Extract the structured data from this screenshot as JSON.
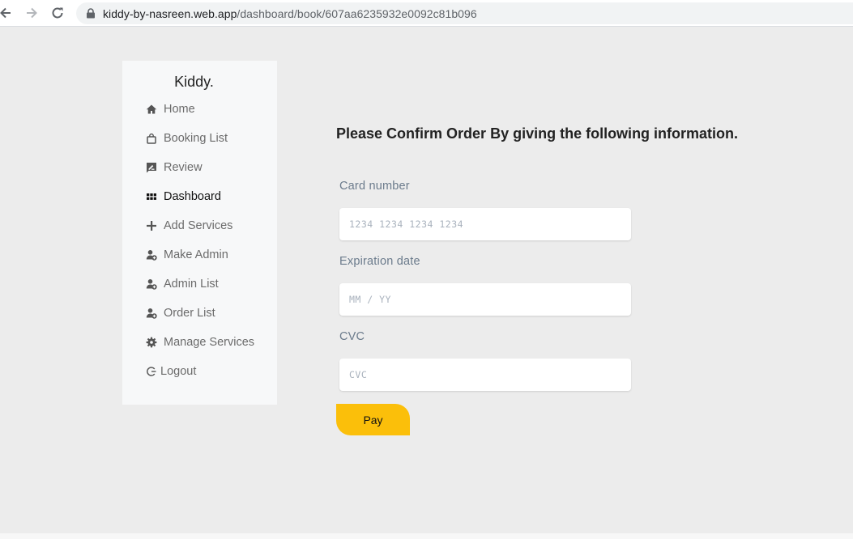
{
  "browser": {
    "url_host": "kiddy-by-nasreen.web.app",
    "url_path": "/dashboard/book/607aa6235932e0092c81b096"
  },
  "sidebar": {
    "brand": "Kiddy.",
    "items": [
      {
        "label": "Home",
        "icon": "home-icon"
      },
      {
        "label": "Booking List",
        "icon": "shopping-bag-icon"
      },
      {
        "label": "Review",
        "icon": "rate-review-icon"
      },
      {
        "label": "Dashboard",
        "icon": "grid-icon",
        "active": true
      },
      {
        "label": "Add Services",
        "icon": "plus-icon"
      },
      {
        "label": "Make Admin",
        "icon": "user-plus-icon"
      },
      {
        "label": "Admin List",
        "icon": "user-plus-icon"
      },
      {
        "label": "Order List",
        "icon": "user-plus-icon"
      },
      {
        "label": "Manage Services",
        "icon": "gear-icon"
      },
      {
        "label": "Logout",
        "icon": "logout-icon"
      }
    ]
  },
  "main": {
    "heading": "Please Confirm Order By giving the following information.",
    "card_number": {
      "label": "Card number",
      "placeholder": "1234 1234 1234 1234",
      "value": ""
    },
    "expiration": {
      "label": "Expiration date",
      "placeholder": "MM / YY",
      "value": ""
    },
    "cvc": {
      "label": "CVC",
      "placeholder": "CVC",
      "value": ""
    },
    "pay_label": "Pay"
  },
  "colors": {
    "page_bg": "#ececec",
    "sidebar_bg": "#f7f8f9",
    "pay_button": "#fbbf0a",
    "label_text": "#6b7b8c"
  }
}
